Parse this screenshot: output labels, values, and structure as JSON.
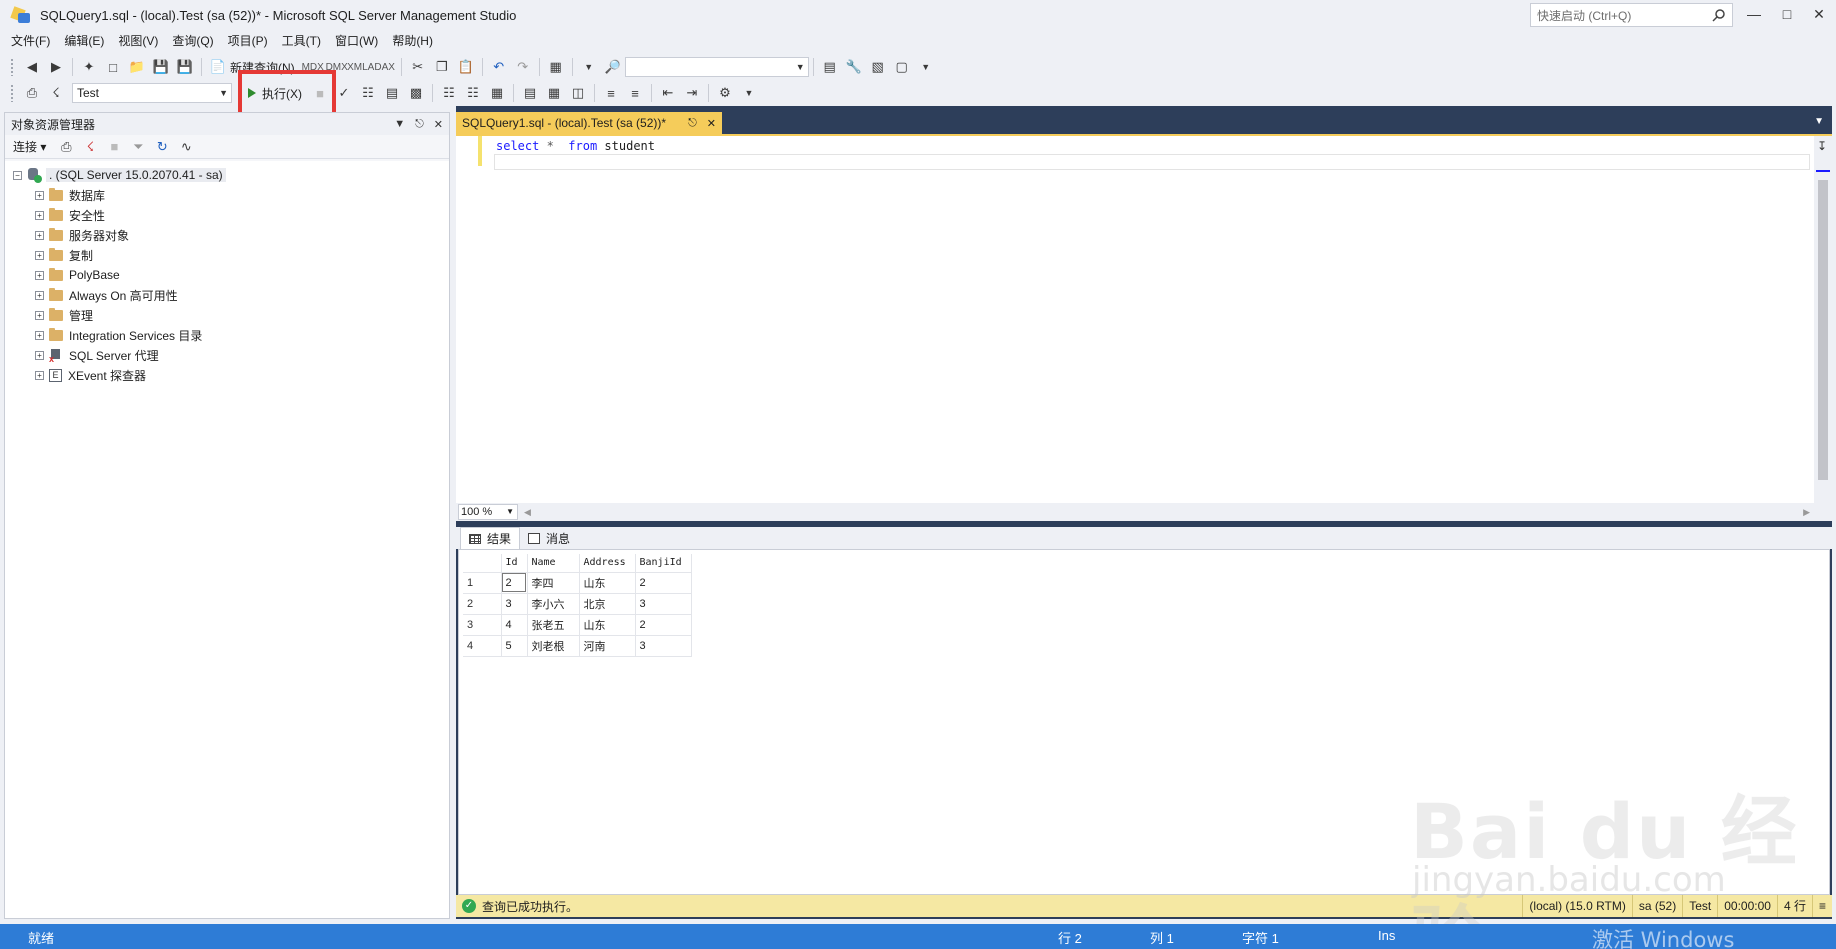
{
  "window": {
    "title": "SQLQuery1.sql - (local).Test (sa (52))* - Microsoft SQL Server Management Studio",
    "quick_launch_placeholder": "快速启动 (Ctrl+Q)"
  },
  "menu": [
    "文件(F)",
    "编辑(E)",
    "视图(V)",
    "查询(Q)",
    "项目(P)",
    "工具(T)",
    "窗口(W)",
    "帮助(H)"
  ],
  "toolbar": {
    "new_query_label": "新建查询(N)",
    "database_selected": "Test",
    "execute_label": "执行(X)"
  },
  "object_explorer": {
    "title": "对象资源管理器",
    "connect_label": "连接",
    "server_node": ". (SQL Server 15.0.2070.41 - sa)",
    "nodes": [
      "数据库",
      "安全性",
      "服务器对象",
      "复制",
      "PolyBase",
      "Always On 高可用性",
      "管理",
      "Integration Services 目录",
      "SQL Server 代理",
      "XEvent 探查器"
    ]
  },
  "editor": {
    "tab_title": "SQLQuery1.sql - (local).Test (sa (52))*",
    "code": {
      "kw_select": "select",
      "star": "*",
      "kw_from": "from",
      "table": "student"
    },
    "zoom": "100 %"
  },
  "results": {
    "tabs": [
      "结果",
      "消息"
    ],
    "columns": [
      "Id",
      "Name",
      "Address",
      "BanjiId"
    ],
    "rows": [
      {
        "num": "1",
        "id": "2",
        "name": "李四",
        "address": "山东",
        "banji": "2"
      },
      {
        "num": "2",
        "id": "3",
        "name": "李小六",
        "address": "北京",
        "banji": "3"
      },
      {
        "num": "3",
        "id": "4",
        "name": "张老五",
        "address": "山东",
        "banji": "2"
      },
      {
        "num": "4",
        "id": "5",
        "name": "刘老根",
        "address": "河南",
        "banji": "3"
      }
    ]
  },
  "query_status": {
    "message": "查询已成功执行。",
    "server": "(local) (15.0 RTM)",
    "user": "sa (52)",
    "database": "Test",
    "elapsed": "00:00:00",
    "rows": "4 行"
  },
  "status_bar": {
    "ready": "就绪",
    "line": "行 2",
    "column": "列 1",
    "char": "字符 1",
    "mode": "Ins"
  },
  "watermark": {
    "brand": "Bai du 经验",
    "url": "jingyan.baidu.com",
    "activate": "激活 Windows"
  }
}
